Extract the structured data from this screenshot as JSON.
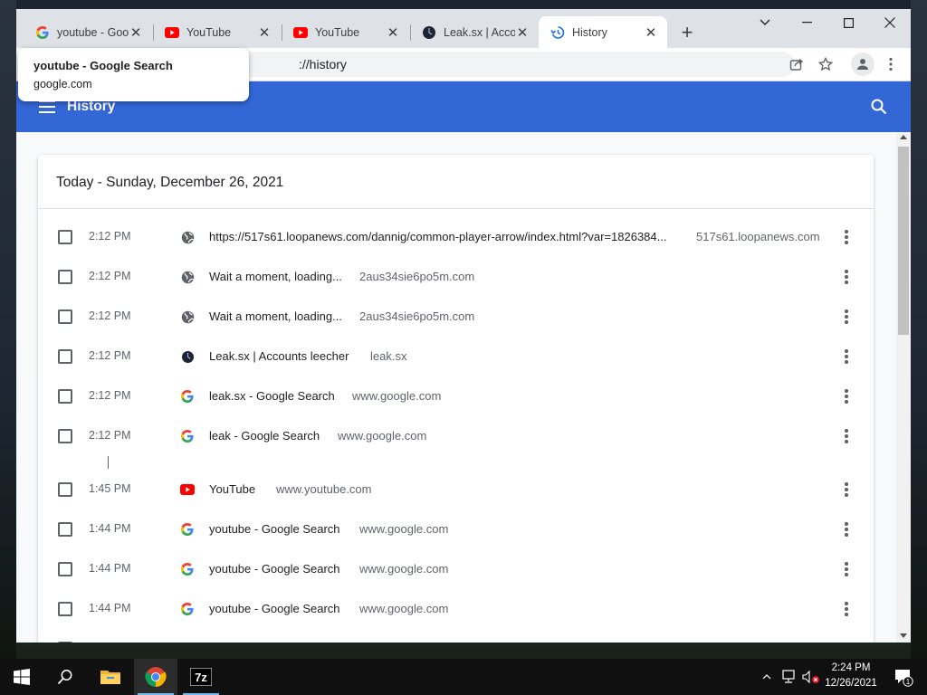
{
  "browser": {
    "tabs": [
      {
        "label": "youtube - Google Search",
        "favicon": "google-icon",
        "active": false
      },
      {
        "label": "YouTube",
        "favicon": "youtube-icon",
        "active": false
      },
      {
        "label": "YouTube",
        "favicon": "youtube-icon",
        "active": false
      },
      {
        "label": "Leak.sx | Accounts leecher",
        "favicon": "leak-icon",
        "active": false
      },
      {
        "label": "History",
        "favicon": "history-icon",
        "active": true
      }
    ],
    "address": "://history",
    "tooltip": {
      "title": "youtube - Google Search",
      "subtitle": "google.com"
    }
  },
  "history": {
    "header_title": "History",
    "section_title": "Today - Sunday, December 26, 2021",
    "entries": [
      {
        "time": "2:12 PM",
        "title": "https://517s61.loopanews.com/dannig/common-player-arrow/index.html?var=1826384...",
        "domain": "517s61.loopanews.com",
        "icon": "globe-icon"
      },
      {
        "time": "2:12 PM",
        "title": "Wait a moment, loading...",
        "domain": "2aus34sie6po5m.com",
        "icon": "globe-icon"
      },
      {
        "time": "2:12 PM",
        "title": "Wait a moment, loading...",
        "domain": "2aus34sie6po5m.com",
        "icon": "globe-icon"
      },
      {
        "time": "2:12 PM",
        "title": "Leak.sx | Accounts leecher",
        "domain": "leak.sx",
        "icon": "leak-icon"
      },
      {
        "time": "2:12 PM",
        "title": "leak.sx - Google Search",
        "domain": "www.google.com",
        "icon": "google-icon"
      },
      {
        "time": "2:12 PM",
        "title": "leak - Google Search",
        "domain": "www.google.com",
        "icon": "google-icon"
      },
      {
        "time": "1:45 PM",
        "title": "YouTube",
        "domain": "www.youtube.com",
        "icon": "youtube-icon"
      },
      {
        "time": "1:44 PM",
        "title": "youtube - Google Search",
        "domain": "www.google.com",
        "icon": "google-icon"
      },
      {
        "time": "1:44 PM",
        "title": "youtube - Google Search",
        "domain": "www.google.com",
        "icon": "google-icon"
      },
      {
        "time": "1:44 PM",
        "title": "youtube - Google Search",
        "domain": "www.google.com",
        "icon": "google-icon"
      }
    ]
  },
  "taskbar": {
    "apps": [
      "file-explorer-icon",
      "chrome-icon",
      "7zip-icon"
    ],
    "clock_time": "2:24 PM",
    "clock_date": "12/26/2021",
    "notification_count": "1"
  },
  "colors": {
    "header_blue": "#3367d6",
    "tab_strip": "#dee1e6",
    "youtube_red": "#ff0000"
  }
}
